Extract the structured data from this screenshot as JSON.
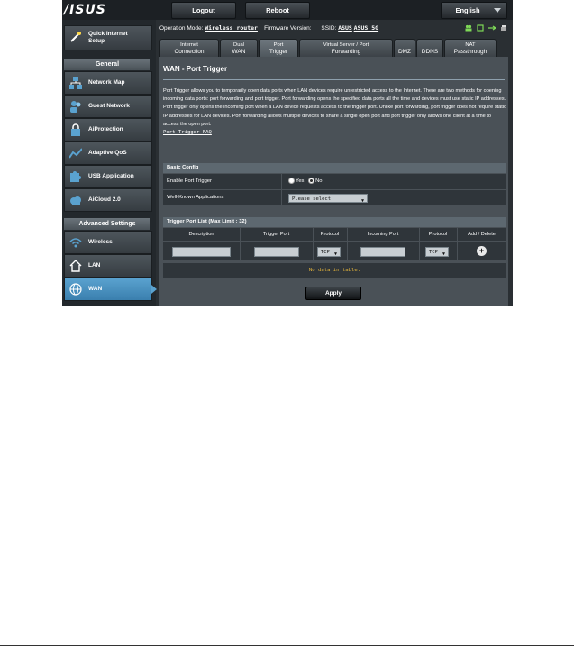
{
  "brand": {
    "logo": "/ISUS"
  },
  "header": {
    "logout": "Logout",
    "reboot": "Reboot",
    "language": "English"
  },
  "status": {
    "operation_mode_label": "Operation Mode:",
    "operation_mode_value": "Wireless router",
    "firmware_label": "Firmware Version:",
    "ssid_label": "SSID:",
    "ssid_1": "ASUS",
    "ssid_2": "ASUS_5G"
  },
  "sidebar": {
    "quick_setup": "Quick Internet Setup",
    "general_head": "General",
    "general_items": [
      "Network Map",
      "Guest Network",
      "AiProtection",
      "Adaptive QoS",
      "USB Application",
      "AiCloud 2.0"
    ],
    "advanced_head": "Advanced Settings",
    "advanced_items": [
      "Wireless",
      "LAN",
      "WAN"
    ]
  },
  "tabs": [
    {
      "l1": "Internet",
      "l2": "Connection"
    },
    {
      "l1": "Dual",
      "l2": "WAN"
    },
    {
      "l1": "Port",
      "l2": "Trigger"
    },
    {
      "l1": "Virtual Server / Port",
      "l2": "Forwarding"
    },
    {
      "l1": "",
      "l2": "DMZ"
    },
    {
      "l1": "",
      "l2": "DDNS"
    },
    {
      "l1": "NAT",
      "l2": "Passthrough"
    }
  ],
  "content": {
    "title": "WAN - Port Trigger",
    "description": "Port Trigger allows you to temporarily open data ports when LAN devices require unrestricted access to the Internet. There are two methods for opening incoming data ports: port forwarding and port trigger. Port forwarding opens the specified data ports all the time and devices must use static IP addresses. Port trigger only opens the incoming port when a LAN device requests access to the trigger port. Unlike port forwarding, port trigger does not require static IP addresses for LAN devices. Port forwarding allows multiple devices to share a single open port and port trigger only allows one client at a time to access the open port.",
    "faq_link": "Port Trigger FAQ",
    "basic_config_head": "Basic Config",
    "enable_label": "Enable Port Trigger",
    "yes": "Yes",
    "no": "No",
    "wellknown_label": "Well-Known Applications",
    "wellknown_value": "Please select",
    "list_head": "Trigger Port List (Max Limit : 32)",
    "columns": [
      "Description",
      "Trigger Port",
      "Protocol",
      "Incoming Port",
      "Protocol",
      "Add / Delete"
    ],
    "protocol_value": "TCP",
    "no_data": "No data in table.",
    "apply": "Apply"
  },
  "colors": {
    "accent": "#5aa2cf",
    "no_data_text": "#e3b43a"
  }
}
